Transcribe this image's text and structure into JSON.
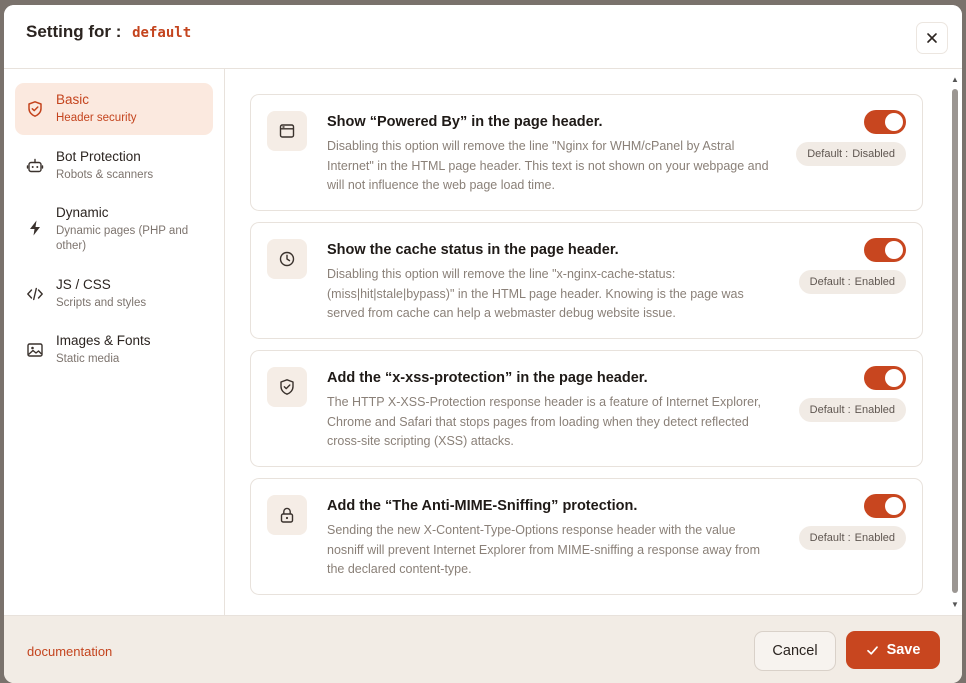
{
  "header": {
    "title_prefix": "Setting for :",
    "profile_name": "default"
  },
  "sidebar": {
    "items": [
      {
        "label": "Basic",
        "sub": "Header security",
        "icon": "shield-icon",
        "active": true
      },
      {
        "label": "Bot Protection",
        "sub": "Robots & scanners",
        "icon": "robot-icon"
      },
      {
        "label": "Dynamic",
        "sub": "Dynamic pages (PHP and other)",
        "icon": "bolt-icon"
      },
      {
        "label": "JS / CSS",
        "sub": "Scripts and styles",
        "icon": "code-icon"
      },
      {
        "label": "Images & Fonts",
        "sub": "Static media",
        "icon": "image-icon"
      }
    ]
  },
  "settings": [
    {
      "title": "Show “Powered By” in the page header.",
      "description": "Disabling this option will remove the line \"Nginx for WHM/cPanel by Astral Internet\" in the HTML page header. This text is not shown on your webpage and will not influence the web page load time.",
      "default_label": "Default :",
      "default_value": "Disabled",
      "enabled": true,
      "icon": "browser-window-icon"
    },
    {
      "title": "Show the cache status in the page header.",
      "description": "Disabling this option will remove the line \"x-nginx-cache-status: (miss|hit|stale|bypass)\" in the HTML page header. Knowing is the page was served from cache can help a webmaster debug website issue.",
      "default_label": "Default :",
      "default_value": "Enabled",
      "enabled": true,
      "icon": "clock-icon"
    },
    {
      "title": "Add the “x-xss-protection” in the page header.",
      "description": "The HTTP X-XSS-Protection response header is a feature of Internet Explorer, Chrome and Safari that stops pages from loading when they detect reflected cross-site scripting (XSS) attacks.",
      "default_label": "Default :",
      "default_value": "Enabled",
      "enabled": true,
      "icon": "shield-check-icon"
    },
    {
      "title": "Add the “The Anti-MIME-Sniffing” protection.",
      "description": "Sending the new X-Content-Type-Options response header with the value nosniff will prevent Internet Explorer from MIME-sniffing a response away from the declared content-type.",
      "default_label": "Default :",
      "default_value": "Enabled",
      "enabled": true,
      "icon": "lock-icon"
    }
  ],
  "footer": {
    "documentation_link": "documentation",
    "cancel_label": "Cancel",
    "save_label": "Save"
  },
  "colors": {
    "accent": "#c8461f",
    "active_bg": "#fbe9df",
    "footer_bg": "#f2ece5"
  }
}
